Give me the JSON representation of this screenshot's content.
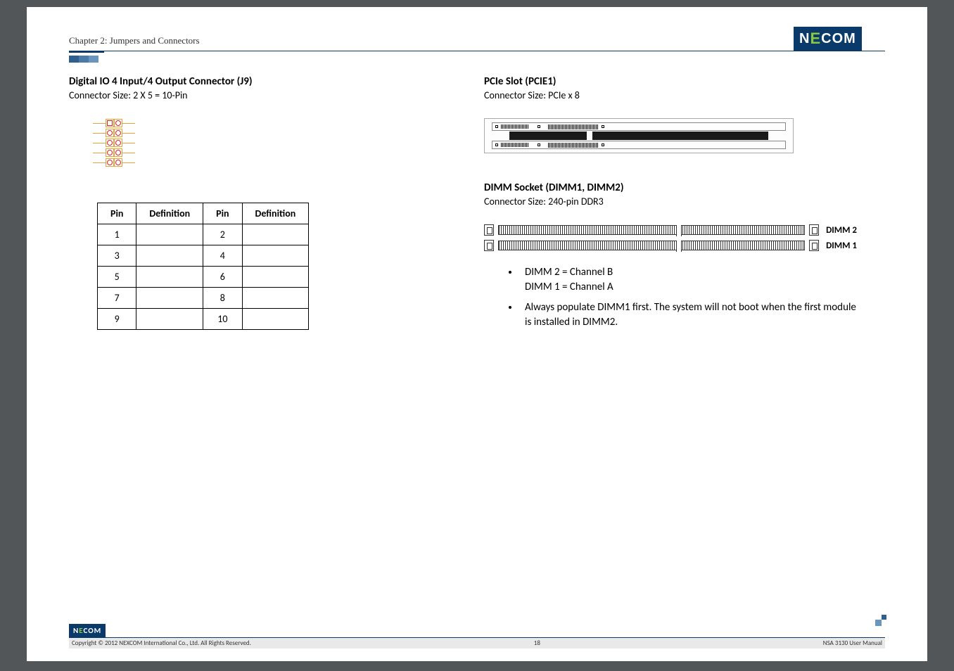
{
  "header": {
    "chapter_line": "Chapter 2: Jumpers and Connectors",
    "logo_text_left": "N",
    "logo_text_mid": "E",
    "logo_text_right": "COM"
  },
  "left": {
    "title": "Digital IO 4 Input/4 Output Connector (J9)",
    "subtitle": "Connector Size: 2 X 5 = 10-Pin",
    "table_headers": {
      "pin": "Pin",
      "def": "Definition"
    },
    "rows": [
      {
        "p1": "1",
        "d1": "",
        "p2": "2",
        "d2": ""
      },
      {
        "p1": "3",
        "d1": "",
        "p2": "4",
        "d2": ""
      },
      {
        "p1": "5",
        "d1": "",
        "p2": "6",
        "d2": ""
      },
      {
        "p1": "7",
        "d1": "",
        "p2": "8",
        "d2": ""
      },
      {
        "p1": "9",
        "d1": "",
        "p2": "10",
        "d2": ""
      }
    ]
  },
  "right": {
    "pcie_title": "PCIe Slot (PCIE1)",
    "pcie_sub": "Connector Size: PCIe x 8",
    "dimm_title": "DIMM Socket (DIMM1, DIMM2)",
    "dimm_sub": "Connector Size: 240-pin DDR3",
    "dimm_labels": {
      "d2": "DIMM 2",
      "d1": "DIMM 1"
    },
    "bullets": [
      "DIMM 2 = Channel B",
      "DIMM 1 = Channel A",
      "Always populate DIMM1 first. The system will not boot when the first module is installed in DIMM2."
    ]
  },
  "footer": {
    "copyright": "Copyright © 2012 NEXCOM International Co., Ltd. All Rights Reserved.",
    "page_num": "18",
    "doc_title": "NSA 3130 User Manual"
  }
}
